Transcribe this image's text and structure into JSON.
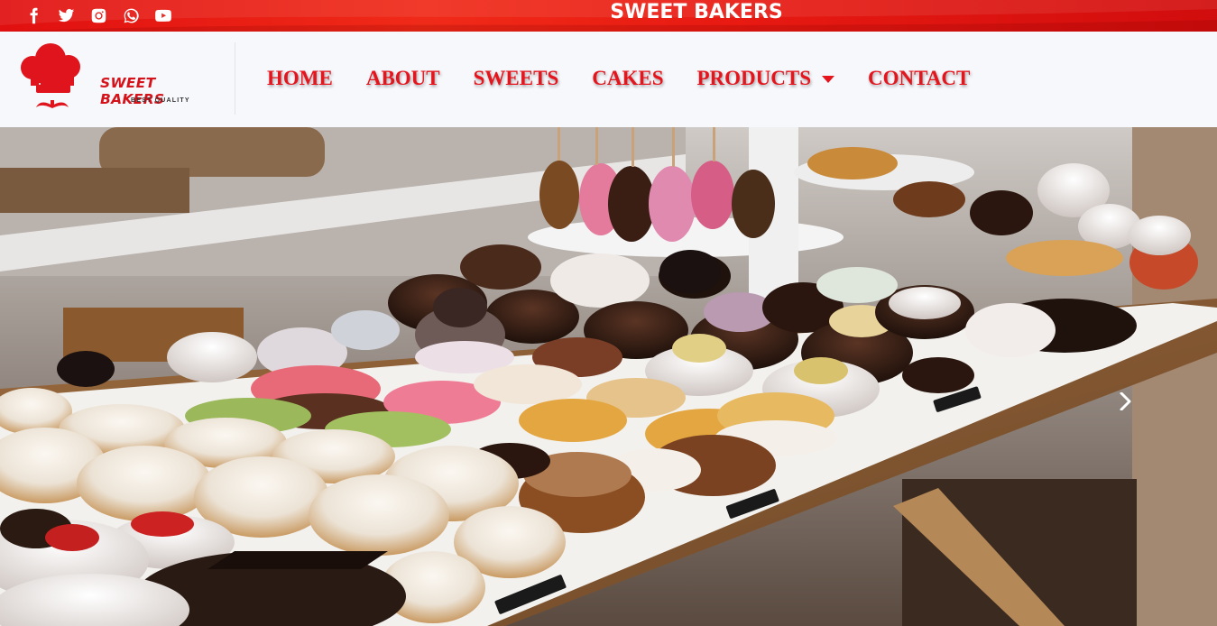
{
  "topbar": {
    "title": "SWEET BAKERS",
    "social_icons": [
      "facebook-icon",
      "twitter-icon",
      "instagram-icon",
      "whatsapp-icon",
      "youtube-icon"
    ],
    "background_color": "#e01010"
  },
  "logo": {
    "brand": "SWEET BAKERS",
    "tagline": "BEST QUALITY",
    "icon": "chef-hat-icon",
    "brand_color": "#d6121a"
  },
  "nav": {
    "items": [
      {
        "label": "HOME"
      },
      {
        "label": "ABOUT"
      },
      {
        "label": "SWEETS"
      },
      {
        "label": "CAKES"
      },
      {
        "label": "PRODUCTS",
        "dropdown": true
      },
      {
        "label": "CONTACT"
      }
    ],
    "link_color": "#e5151d"
  },
  "hero": {
    "image": "bakery display of donuts, cupcakes and cake pops on a wooden table",
    "next_control": "chevron-right-icon"
  }
}
